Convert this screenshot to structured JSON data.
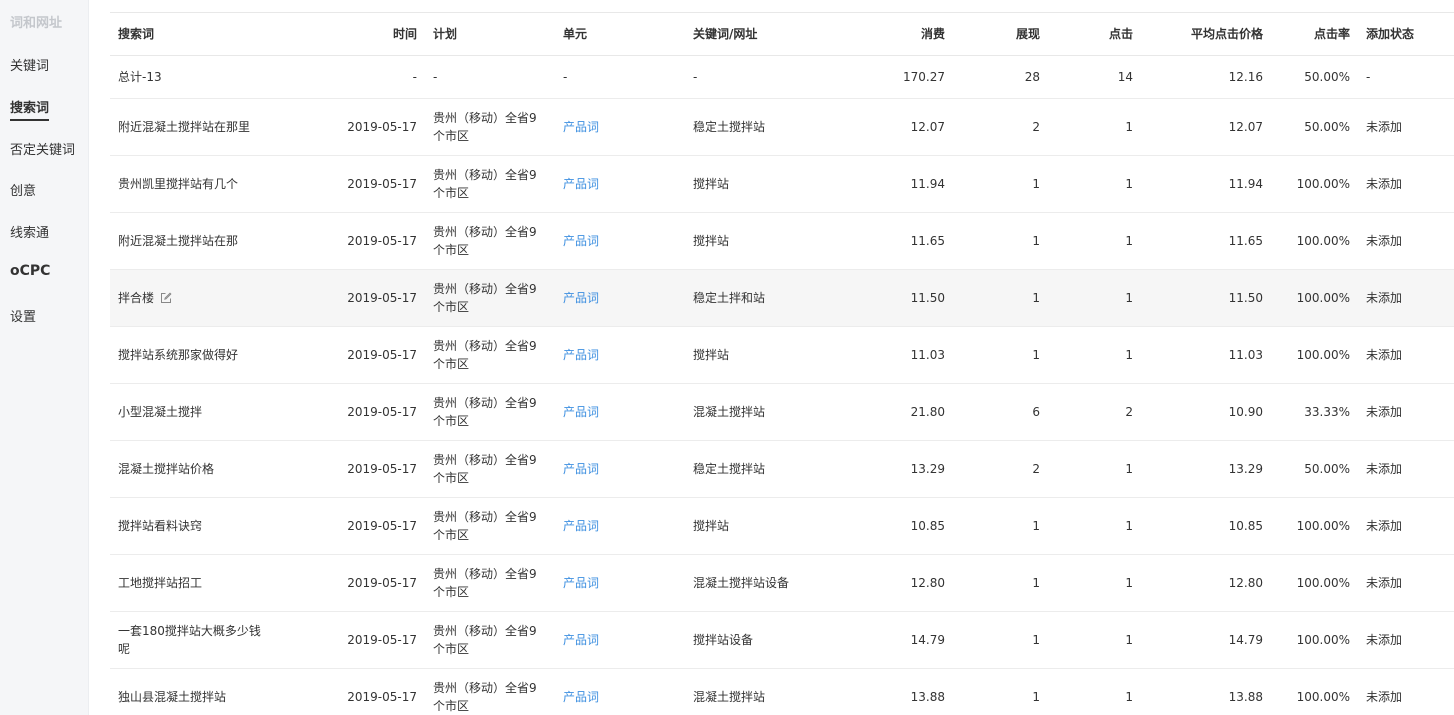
{
  "sidebar": {
    "section_title": "词和网址",
    "items": [
      {
        "label": "关键词"
      },
      {
        "label": "搜索词"
      },
      {
        "label": "否定关键词"
      },
      {
        "label": "创意"
      },
      {
        "label": "线索通"
      },
      {
        "label": "oCPC"
      },
      {
        "label": "设置"
      }
    ]
  },
  "table": {
    "headers": {
      "search_term": "搜索词",
      "time": "时间",
      "plan": "计划",
      "unit": "单元",
      "keyword": "关键词/网址",
      "cost": "消费",
      "impressions": "展现",
      "clicks": "点击",
      "avg_cpc": "平均点击价格",
      "ctr": "点击率",
      "status": "添加状态"
    },
    "total": {
      "search_term": "总计-13",
      "time": "-",
      "plan": "-",
      "unit": "-",
      "keyword": "-",
      "cost": "170.27",
      "impressions": "28",
      "clicks": "14",
      "avg_cpc": "12.16",
      "ctr": "50.00%",
      "status": "-"
    },
    "rows": [
      {
        "search_term": "附近混凝土搅拌站在那里",
        "time": "2019-05-17",
        "plan": "贵州（移动）全省9个市区",
        "unit": "产品词",
        "keyword": "稳定土搅拌站",
        "cost": "12.07",
        "impressions": "2",
        "clicks": "1",
        "avg_cpc": "12.07",
        "ctr": "50.00%",
        "status": "未添加"
      },
      {
        "search_term": "贵州凯里搅拌站有几个",
        "time": "2019-05-17",
        "plan": "贵州（移动）全省9个市区",
        "unit": "产品词",
        "keyword": "搅拌站",
        "cost": "11.94",
        "impressions": "1",
        "clicks": "1",
        "avg_cpc": "11.94",
        "ctr": "100.00%",
        "status": "未添加"
      },
      {
        "search_term": "附近混凝土搅拌站在那",
        "time": "2019-05-17",
        "plan": "贵州（移动）全省9个市区",
        "unit": "产品词",
        "keyword": "搅拌站",
        "cost": "11.65",
        "impressions": "1",
        "clicks": "1",
        "avg_cpc": "11.65",
        "ctr": "100.00%",
        "status": "未添加"
      },
      {
        "search_term": "拌合楼",
        "time": "2019-05-17",
        "plan": "贵州（移动）全省9个市区",
        "unit": "产品词",
        "keyword": "稳定土拌和站",
        "cost": "11.50",
        "impressions": "1",
        "clicks": "1",
        "avg_cpc": "11.50",
        "ctr": "100.00%",
        "status": "未添加"
      },
      {
        "search_term": "搅拌站系统那家做得好",
        "time": "2019-05-17",
        "plan": "贵州（移动）全省9个市区",
        "unit": "产品词",
        "keyword": "搅拌站",
        "cost": "11.03",
        "impressions": "1",
        "clicks": "1",
        "avg_cpc": "11.03",
        "ctr": "100.00%",
        "status": "未添加"
      },
      {
        "search_term": "小型混凝土搅拌",
        "time": "2019-05-17",
        "plan": "贵州（移动）全省9个市区",
        "unit": "产品词",
        "keyword": "混凝土搅拌站",
        "cost": "21.80",
        "impressions": "6",
        "clicks": "2",
        "avg_cpc": "10.90",
        "ctr": "33.33%",
        "status": "未添加"
      },
      {
        "search_term": "混凝土搅拌站价格",
        "time": "2019-05-17",
        "plan": "贵州（移动）全省9个市区",
        "unit": "产品词",
        "keyword": "稳定土搅拌站",
        "cost": "13.29",
        "impressions": "2",
        "clicks": "1",
        "avg_cpc": "13.29",
        "ctr": "50.00%",
        "status": "未添加"
      },
      {
        "search_term": "搅拌站看料诀窍",
        "time": "2019-05-17",
        "plan": "贵州（移动）全省9个市区",
        "unit": "产品词",
        "keyword": "搅拌站",
        "cost": "10.85",
        "impressions": "1",
        "clicks": "1",
        "avg_cpc": "10.85",
        "ctr": "100.00%",
        "status": "未添加"
      },
      {
        "search_term": "工地搅拌站招工",
        "time": "2019-05-17",
        "plan": "贵州（移动）全省9个市区",
        "unit": "产品词",
        "keyword": "混凝土搅拌站设备",
        "cost": "12.80",
        "impressions": "1",
        "clicks": "1",
        "avg_cpc": "12.80",
        "ctr": "100.00%",
        "status": "未添加"
      },
      {
        "search_term": "一套180搅拌站大概多少钱呢",
        "time": "2019-05-17",
        "plan": "贵州（移动）全省9个市区",
        "unit": "产品词",
        "keyword": "搅拌站设备",
        "cost": "14.79",
        "impressions": "1",
        "clicks": "1",
        "avg_cpc": "14.79",
        "ctr": "100.00%",
        "status": "未添加"
      },
      {
        "search_term": "独山县混凝土搅拌站",
        "time": "2019-05-17",
        "plan": "贵州（移动）全省9个市区",
        "unit": "产品词",
        "keyword": "混凝土搅拌站",
        "cost": "13.88",
        "impressions": "1",
        "clicks": "1",
        "avg_cpc": "13.88",
        "ctr": "100.00%",
        "status": "未添加"
      }
    ]
  },
  "colors": {
    "link": "#3d8fe0",
    "sidebar_bg": "#f5f6f8",
    "hover_row": "#f6f6f6"
  },
  "icons": {
    "edit": "edit-icon"
  }
}
